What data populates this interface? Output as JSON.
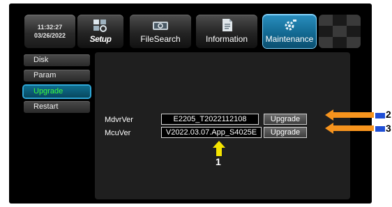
{
  "clock": {
    "time": "11:32:27",
    "date": "03/26/2022"
  },
  "tabs": [
    {
      "label": "Setup",
      "icon": "setup-icon"
    },
    {
      "label": "FileSearch",
      "icon": "file-search-icon"
    },
    {
      "label": "Information",
      "icon": "information-icon"
    },
    {
      "label": "Maintenance",
      "icon": "maintenance-icon",
      "active": true
    }
  ],
  "sidebar": {
    "items": [
      {
        "label": "Disk"
      },
      {
        "label": "Param"
      },
      {
        "label": "Upgrade",
        "active": true
      },
      {
        "label": "Restart"
      }
    ]
  },
  "versions": [
    {
      "label": "MdvrVer",
      "value": "E2205_T2022112108",
      "button": "Upgrade"
    },
    {
      "label": "McuVer",
      "value": "V2022.03.07.App_S4025E",
      "button": "Upgrade"
    }
  ],
  "annotations": {
    "callout_1": "1",
    "callout_2": "2",
    "callout_3": "3",
    "arrow_color": "#f7941d",
    "pointer_color": "#f5e400",
    "marker_color": "#1f4fd6"
  }
}
